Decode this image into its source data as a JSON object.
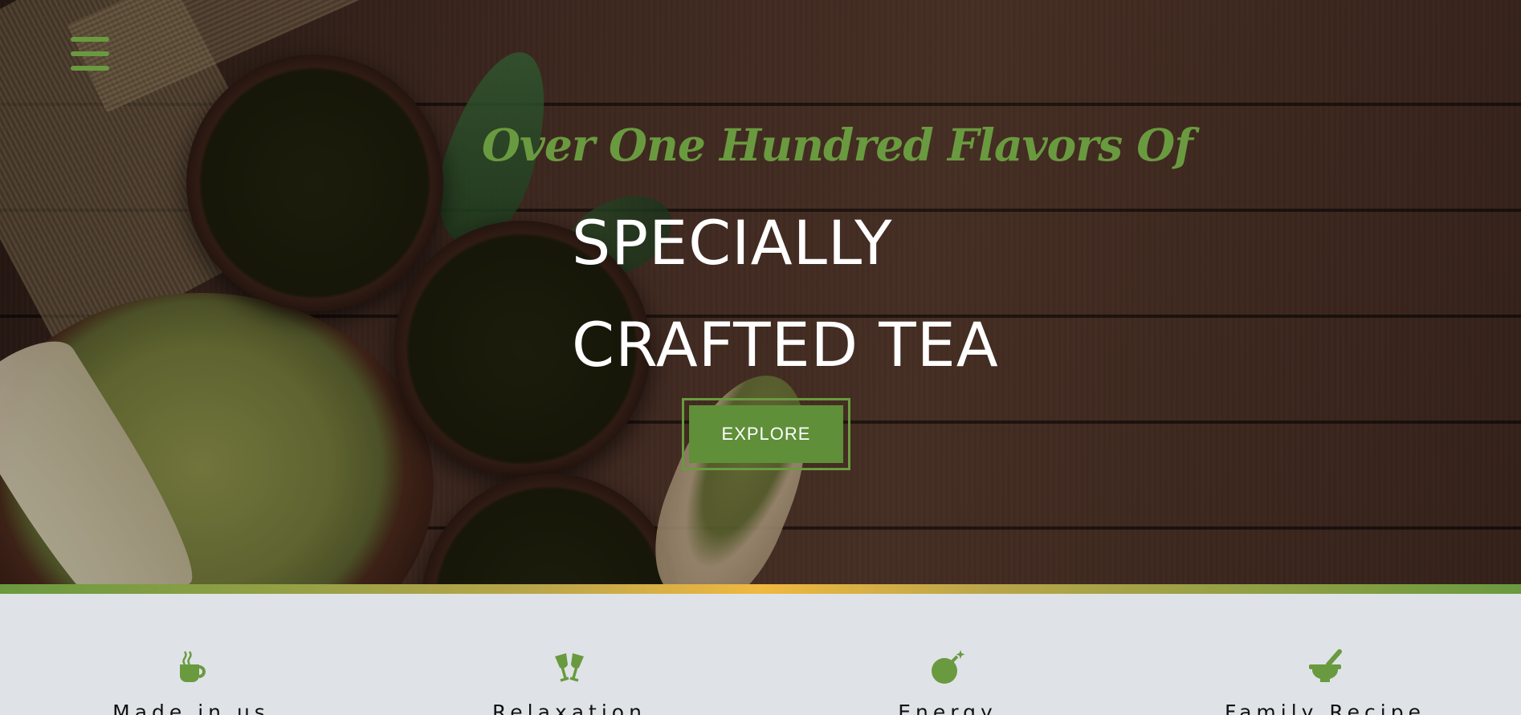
{
  "colors": {
    "accent": "#6a9a3f",
    "button": "#5f8f38",
    "gold": "#f0b840",
    "section_bg": "#dfe3e8"
  },
  "nav": {
    "menu_icon": "hamburger-menu-icon"
  },
  "hero": {
    "tagline": "Over One Hundred Flavors Of",
    "headline_line1": "SPECIALLY",
    "headline_line2": "CRAFTED TEA",
    "explore_label": "EXPLORE"
  },
  "features": [
    {
      "label": "Made in us",
      "icon": "steaming-cup-icon"
    },
    {
      "label": "Relaxation",
      "icon": "toasting-glasses-icon"
    },
    {
      "label": "Energy",
      "icon": "bomb-icon"
    },
    {
      "label": "Family Recipe",
      "icon": "mortar-pestle-icon"
    }
  ]
}
